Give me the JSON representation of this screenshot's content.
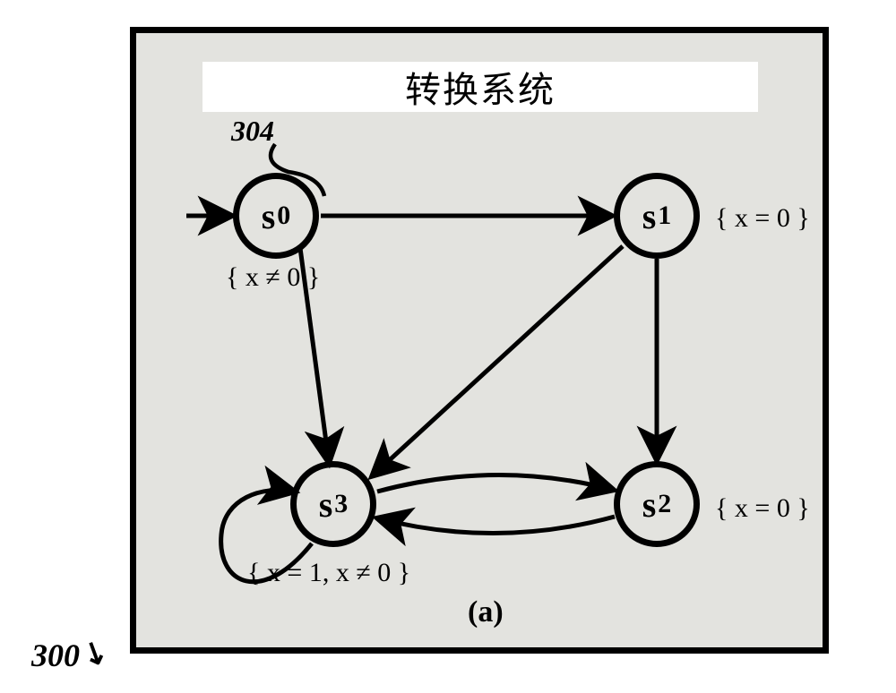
{
  "figure_ref": "300",
  "panel": {
    "title": "转换系统",
    "callout": "304",
    "sublabel": "(a)",
    "states": {
      "s0": {
        "label": "s",
        "sub": "0",
        "prop": "{ x ≠ 0 }"
      },
      "s1": {
        "label": "s",
        "sub": "1",
        "prop": "{ x = 0 }"
      },
      "s2": {
        "label": "s",
        "sub": "2",
        "prop": "{ x = 0 }"
      },
      "s3": {
        "label": "s",
        "sub": "3",
        "prop": "{ x = 1, x ≠ 0 }"
      }
    }
  },
  "chart_data": {
    "type": "transition_system",
    "initial_state": "s0",
    "states": [
      {
        "id": "s0",
        "propositions": [
          "x≠0"
        ]
      },
      {
        "id": "s1",
        "propositions": [
          "x=0"
        ]
      },
      {
        "id": "s2",
        "propositions": [
          "x=0"
        ]
      },
      {
        "id": "s3",
        "propositions": [
          "x=1",
          "x≠0"
        ]
      }
    ],
    "transitions": [
      {
        "from": "s0",
        "to": "s1"
      },
      {
        "from": "s0",
        "to": "s3"
      },
      {
        "from": "s1",
        "to": "s2"
      },
      {
        "from": "s1",
        "to": "s3"
      },
      {
        "from": "s2",
        "to": "s3"
      },
      {
        "from": "s3",
        "to": "s2"
      },
      {
        "from": "s3",
        "to": "s3"
      }
    ]
  }
}
